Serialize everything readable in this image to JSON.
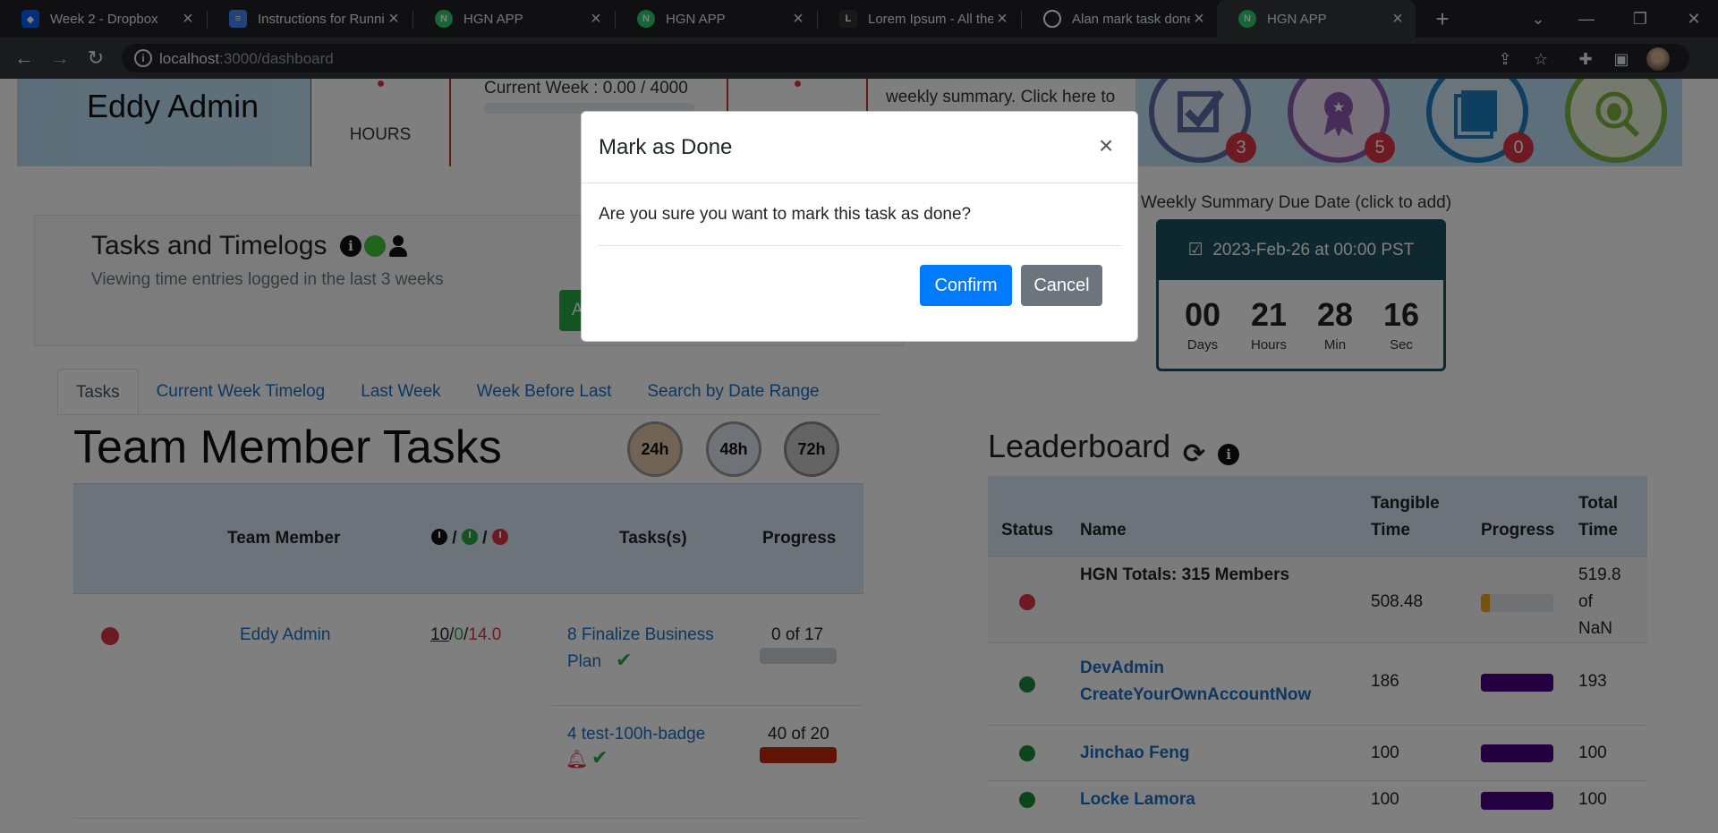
{
  "browser": {
    "tabs": [
      {
        "title": "Week 2 - Dropbox",
        "icon": "dropbox-icon",
        "color": "#0061fe"
      },
      {
        "title": "Instructions for Runnin",
        "icon": "google-docs-icon",
        "color": "#4285f4"
      },
      {
        "title": "HGN APP",
        "icon": "hgn-icon",
        "color": "#2ecc71"
      },
      {
        "title": "HGN APP",
        "icon": "hgn-icon",
        "color": "#2ecc71"
      },
      {
        "title": "Lorem Ipsum - All the",
        "icon": "lorem-icon",
        "color": "#444444"
      },
      {
        "title": "Alan mark task done c",
        "icon": "github-icon",
        "color": "#ffffff"
      },
      {
        "title": "HGN APP",
        "icon": "hgn-icon",
        "color": "#2ecc71"
      }
    ],
    "url_host": "localhost",
    "url_path": ":3000/dashboard"
  },
  "banner": {
    "user_name": "Eddy Admin",
    "hours_label": "HOURS",
    "current_week": "Current Week : 0.00 / 4000",
    "summary_text": "weekly summary. Click here to",
    "badges": [
      {
        "name": "criteria-badge",
        "count": "3",
        "color": "#5b6fa8"
      },
      {
        "name": "earned-badge",
        "count": "5",
        "color": "#8a5ab0"
      },
      {
        "name": "record-badge",
        "count": "0",
        "color": "#1f7fc1"
      },
      {
        "name": "app-bug-badge",
        "count": "",
        "color": "#7ab640"
      }
    ]
  },
  "timelogs": {
    "title": "Tasks and Timelogs",
    "subtitle": "Viewing time entries logged in the last 3 weeks",
    "tabs": [
      "Tasks",
      "Current Week Timelog",
      "Last Week",
      "Week Before Last",
      "Search by Date Range"
    ]
  },
  "team_tasks": {
    "title": "Team Member Tasks",
    "hour_filters": [
      "24h",
      "48h",
      "72h"
    ],
    "headers": {
      "member": "Team Member",
      "tasks": "Tasks(s)",
      "progress": "Progress"
    },
    "rows": [
      {
        "member": "Eddy Admin",
        "hours_committed": "10",
        "hours_green": "0",
        "hours_red": "14.0",
        "tasks": [
          {
            "line1": "8 Finalize Business",
            "line2": "Plan",
            "progress": "0 of 17",
            "fill": 0
          },
          {
            "line1": "4 test-100h-badge",
            "line2": "",
            "progress": "40 of 20",
            "fill": 1.0
          }
        ]
      }
    ]
  },
  "summary_due": {
    "label": "Weekly Summary Due Date (click to add)",
    "date": "2023-Feb-26 at 00:00 PST",
    "countdown": [
      {
        "value": "00",
        "unit": "Days"
      },
      {
        "value": "21",
        "unit": "Hours"
      },
      {
        "value": "28",
        "unit": "Min"
      },
      {
        "value": "16",
        "unit": "Sec"
      }
    ]
  },
  "leaderboard": {
    "title": "Leaderboard",
    "headers": {
      "status": "Status",
      "name": "Name",
      "tangible1": "Tangible",
      "tangible2": "Time",
      "progress": "Progress",
      "total1": "Total",
      "total2": "Time"
    },
    "totals": {
      "name": "HGN Totals: 315 Members",
      "tangible": "508.48",
      "total1": "519.8",
      "total2": "of",
      "total3": "NaN",
      "fill": 0.12,
      "color": "#f0a020"
    },
    "rows": [
      {
        "name1": "DevAdmin",
        "name2": "CreateYourOwnAccountNow",
        "tangible": "186",
        "total": "193",
        "fill": 1.0,
        "color": "#4b0082"
      },
      {
        "name1": "Jinchao Feng",
        "name2": "",
        "tangible": "100",
        "total": "100",
        "fill": 1.0,
        "color": "#4b0082"
      },
      {
        "name1": "Locke Lamora",
        "name2": "",
        "tangible": "100",
        "total": "100",
        "fill": 1.0,
        "color": "#4b0082"
      }
    ]
  },
  "modal": {
    "title": "Mark as Done",
    "close": "×",
    "body": "Are you sure you want to mark this task as done?",
    "confirm": "Confirm",
    "cancel": "Cancel"
  }
}
